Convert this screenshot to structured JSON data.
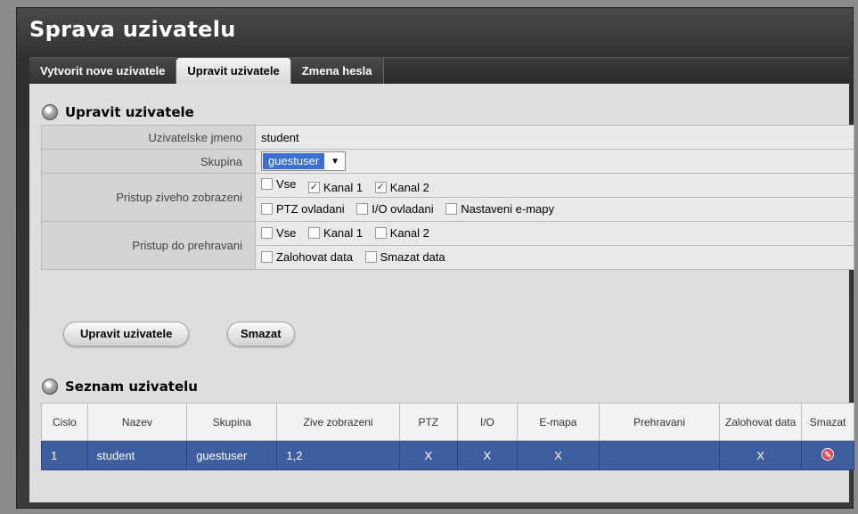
{
  "page": {
    "title": "Sprava uzivatelu"
  },
  "tabs": [
    {
      "label": "Vytvorit nove uzivatele",
      "active": false
    },
    {
      "label": "Upravit uzivatele",
      "active": true
    },
    {
      "label": "Zmena hesla",
      "active": false
    }
  ],
  "edit_section": {
    "heading": "Upravit uzivatele",
    "username_label": "Uzivatelske jmeno",
    "username_value": "student",
    "group_label": "Skupina",
    "group_value": "guestuser",
    "live_label": "Pristup ziveho zobrazeni",
    "live_options": {
      "all": {
        "label": "Vse",
        "checked": false
      },
      "ch1": {
        "label": "Kanal 1",
        "checked": true
      },
      "ch2": {
        "label": "Kanal 2",
        "checked": true
      },
      "ptz": {
        "label": "PTZ ovladani",
        "checked": false
      },
      "io": {
        "label": "I/O ovladani",
        "checked": false
      },
      "emap": {
        "label": "Nastaveni e-mapy",
        "checked": false
      }
    },
    "playback_label": "Pristup do prehravani",
    "playback_options": {
      "all": {
        "label": "Vse",
        "checked": false
      },
      "ch1": {
        "label": "Kanal 1",
        "checked": false
      },
      "ch2": {
        "label": "Kanal 2",
        "checked": false
      },
      "backup": {
        "label": "Zalohovat data",
        "checked": false
      },
      "delete": {
        "label": "Smazat data",
        "checked": false
      }
    },
    "edit_button": "Upravit uzivatele",
    "delete_button": "Smazat"
  },
  "list_section": {
    "heading": "Seznam uzivatelu",
    "columns": [
      "Cislo",
      "Nazev",
      "Skupina",
      "Zive zobrazeni",
      "PTZ",
      "I/O",
      "E-mapa",
      "Prehravani",
      "Zalohovat data",
      "Smazat"
    ],
    "rows": [
      {
        "number": "1",
        "name": "student",
        "group": "guestuser",
        "live": "1,2",
        "ptz": "X",
        "io": "X",
        "emap": "X",
        "playback": "",
        "backup": "X",
        "delete_icon": "delete-icon"
      }
    ]
  },
  "colors": {
    "selected_row": "#3e5ea0",
    "select_highlight": "#3a6ed6"
  }
}
